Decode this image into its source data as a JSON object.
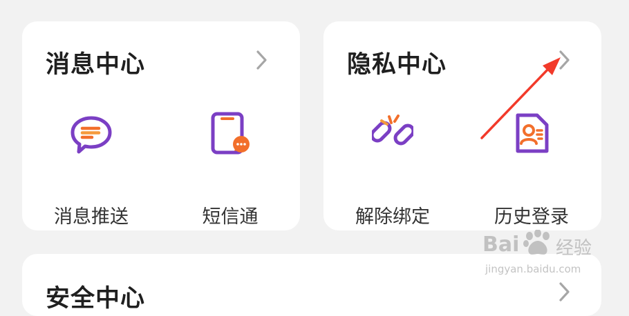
{
  "message_center": {
    "title": "消息中心",
    "items": [
      {
        "label": "消息推送",
        "icon": "chat-bubble-icon"
      },
      {
        "label": "短信通",
        "icon": "phone-message-icon"
      }
    ]
  },
  "privacy_center": {
    "title": "隐私中心",
    "items": [
      {
        "label": "解除绑定",
        "icon": "broken-link-icon"
      },
      {
        "label": "历史登录",
        "icon": "user-document-icon"
      }
    ]
  },
  "security_center": {
    "title": "安全中心"
  },
  "annotation": {
    "arrow_color": "#f23a2a"
  },
  "watermark": {
    "brand_left": "Bai",
    "brand_right": "经验",
    "url": "jingyan.baidu.com"
  },
  "colors": {
    "background": "#f2f2f2",
    "card": "#ffffff",
    "icon_purple": "#7b3fc4",
    "icon_orange": "#f26f2b"
  }
}
